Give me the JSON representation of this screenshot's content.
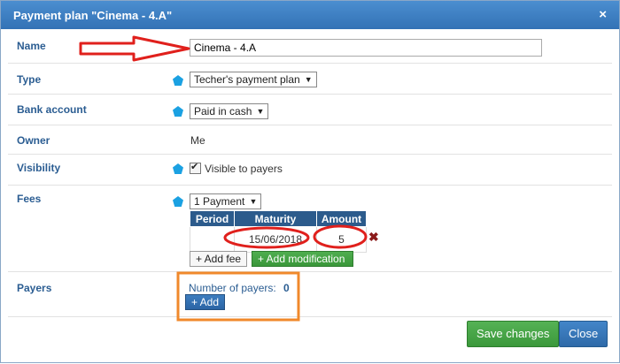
{
  "dialog": {
    "title": "Payment plan \"Cinema - 4.A\"",
    "close_glyph": "×"
  },
  "fields": {
    "name": {
      "label": "Name",
      "value": "Cinema - 4.A"
    },
    "type": {
      "label": "Type",
      "value": "Techer's payment plan"
    },
    "bank_account": {
      "label": "Bank account",
      "value": "Paid in cash"
    },
    "owner": {
      "label": "Owner",
      "value": "Me"
    },
    "visibility": {
      "label": "Visibility",
      "checkbox_label": "Visible to payers",
      "checked": true
    },
    "fees": {
      "label": "Fees",
      "payments_select": "1 Payment",
      "columns": [
        "Period",
        "Maturity",
        "Amount"
      ],
      "rows": [
        {
          "period": "",
          "maturity": "15/06/2018",
          "amount": "5"
        }
      ],
      "add_fee_label": "+ Add fee",
      "add_modification_label": "+ Add modification",
      "delete_glyph": "✖"
    },
    "payers": {
      "label": "Payers",
      "count_label": "Number of payers:",
      "count": "0",
      "add_label": "+ Add"
    }
  },
  "footer": {
    "save_label": "Save changes",
    "close_label": "Close"
  },
  "colors": {
    "header": "#3a7bc0",
    "label": "#2b5d92",
    "annotation_red": "#e0201c",
    "annotation_orange": "#f0892b"
  },
  "icons": {
    "hint": "pentagon-hint-icon"
  }
}
